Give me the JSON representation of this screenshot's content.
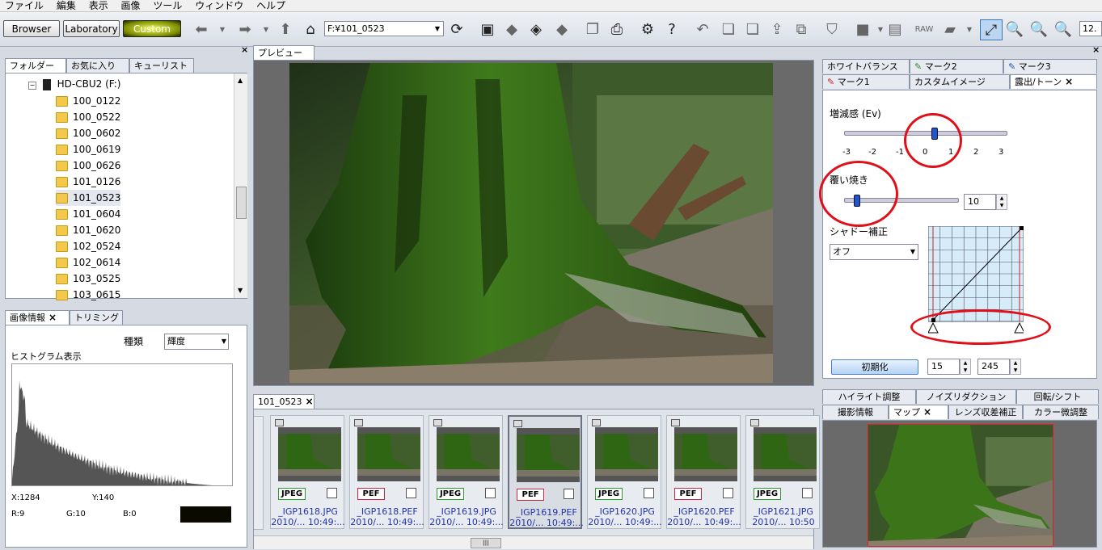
{
  "menu": [
    "ファイル",
    "編集",
    "表示",
    "画像",
    "ツール",
    "ウィンドウ",
    "ヘルプ"
  ],
  "modes": {
    "browser": "Browser",
    "laboratory": "Laboratory",
    "custom": "Custom"
  },
  "address": "F:¥101_0523",
  "zoom": "12.",
  "folder_panel": {
    "tabs": [
      "フォルダー",
      "お気に入り",
      "キューリスト"
    ],
    "drive": "HD-CBU2 (F:)",
    "folders": [
      "100_0122",
      "100_0522",
      "100_0602",
      "100_0619",
      "100_0626",
      "101_0126",
      "101_0523",
      "101_0604",
      "101_0620",
      "102_0524",
      "102_0614",
      "103_0525",
      "103_0615"
    ],
    "selected": "101_0523"
  },
  "info_panel": {
    "tabs": [
      "画像情報",
      "トリミング"
    ],
    "kind_label": "種類",
    "kind_value": "輝度",
    "histogram_label": "ヒストグラム表示",
    "x_label": "X:1284",
    "y_label": "Y:140",
    "r_label": "R:9",
    "g_label": "G:10",
    "b_label": "B:0"
  },
  "preview_tab": "プレビュー",
  "film_tab": "101_0523",
  "thumbnails": [
    {
      "type": "JPEG",
      "name": "_IGP1618.JPG",
      "date": "2010/... 10:49:..."
    },
    {
      "type": "PEF",
      "name": "_IGP1618.PEF",
      "date": "2010/... 10:49:..."
    },
    {
      "type": "JPEG",
      "name": "_IGP1619.JPG",
      "date": "2010/... 10:49:..."
    },
    {
      "type": "PEF",
      "name": "_IGP1619.PEF",
      "date": "2010/... 10:49:..."
    },
    {
      "type": "JPEG",
      "name": "_IGP1620.JPG",
      "date": "2010/... 10:49:..."
    },
    {
      "type": "PEF",
      "name": "_IGP1620.PEF",
      "date": "2010/... 10:49:..."
    },
    {
      "type": "JPEG",
      "name": "_IGP1621.JPG",
      "date": "2010/... 10:50"
    }
  ],
  "adjust_panel": {
    "tabs_row1": [
      "ホワイトバランス",
      "マーク2",
      "マーク3"
    ],
    "tabs_row2": [
      "マーク1",
      "カスタムイメージ",
      "露出/トーン"
    ],
    "ev_label": "増減感 (Ev)",
    "ev_ticks": [
      "-3",
      "-2",
      "-1",
      "0",
      "1",
      "2",
      "3"
    ],
    "dodge_label": "覆い焼き",
    "dodge_value": "10",
    "shadow_label": "シャドー補正",
    "shadow_value": "オフ",
    "reset_label": "初期化",
    "low_value": "15",
    "high_value": "245"
  },
  "bottom_right": {
    "tabs_row1": [
      "ハイライト調整",
      "ノイズリダクション",
      "回転/シフト"
    ],
    "tabs_row2": [
      "撮影情報",
      "マップ",
      "レンズ収差補正",
      "カラー微調整"
    ]
  }
}
